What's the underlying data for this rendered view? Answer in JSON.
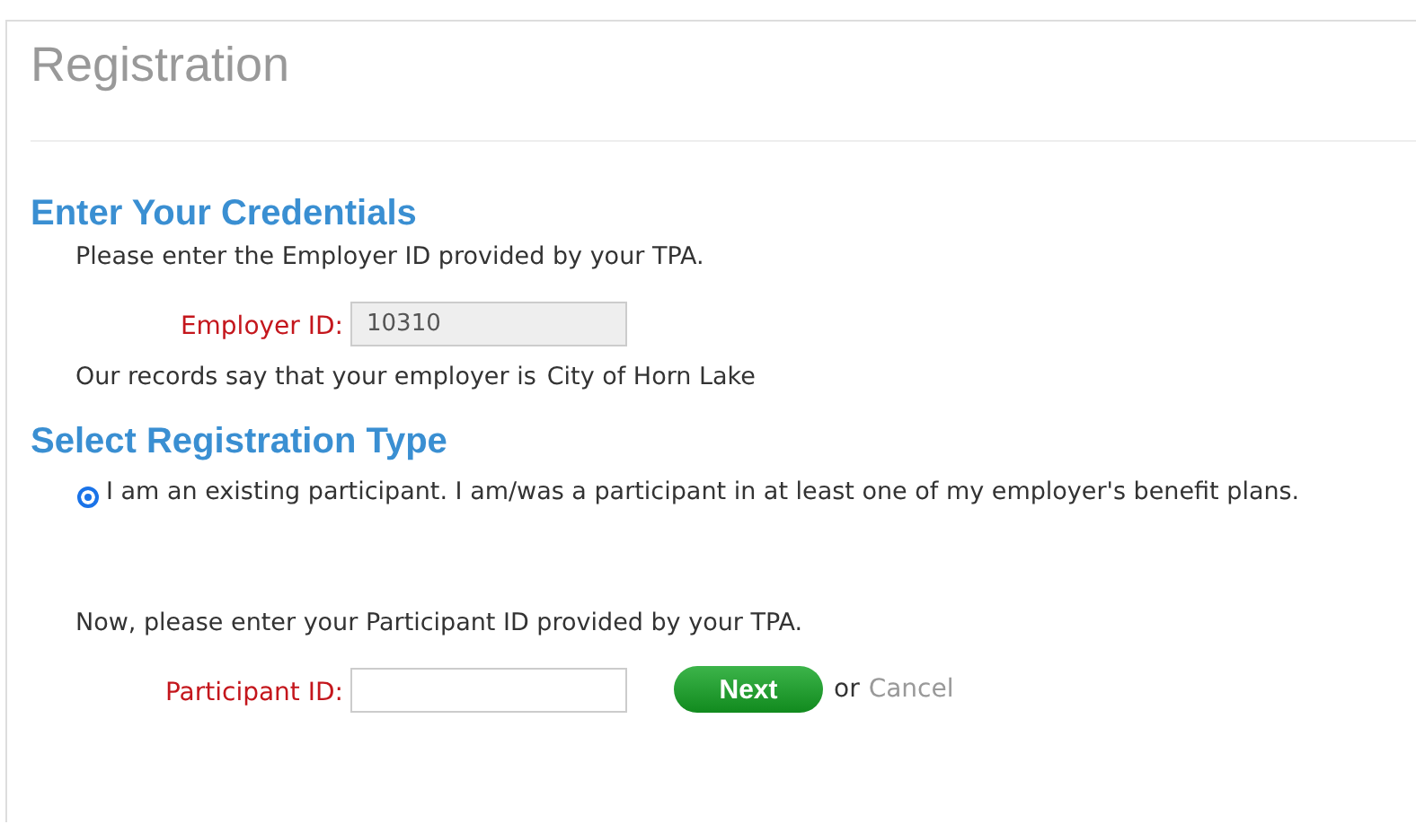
{
  "page_title": "Registration",
  "credentials": {
    "heading": "Enter Your Credentials",
    "instruction": "Please enter the Employer ID provided by your TPA.",
    "employer_id": {
      "label": "Employer ID:",
      "value": "10310",
      "disabled": true
    },
    "records_text": "Our records say that your employer is",
    "employer_name": "City of Horn Lake"
  },
  "registration_type": {
    "heading": "Select Registration Type",
    "options": [
      {
        "label": "I am an existing participant. I am/was a participant in at least one of my employer's benefit plans.",
        "selected": true
      }
    ],
    "instruction": "Now, please enter your Participant ID provided by your TPA.",
    "participant_id": {
      "label": "Participant ID:"
    },
    "next_button": "Next",
    "or_text": "or",
    "cancel_link": "Cancel"
  }
}
